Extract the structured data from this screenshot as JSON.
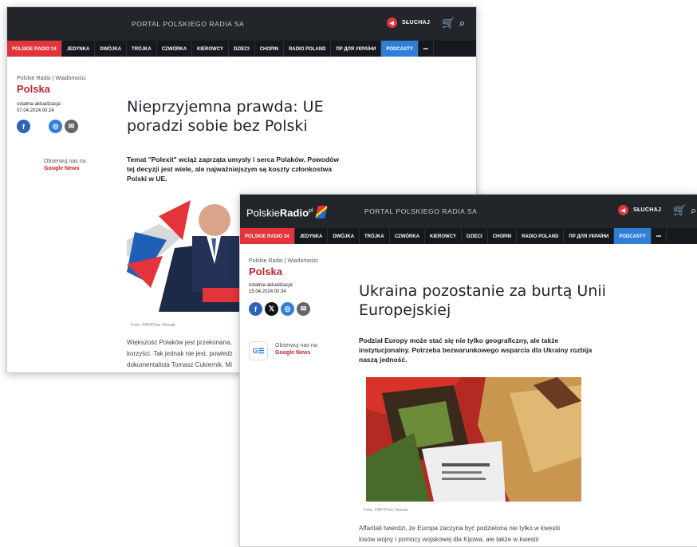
{
  "window1": {
    "portal": "PORTAL POLSKIEGO RADIA SA",
    "listen_label": "SŁUCHAJ",
    "nav": [
      "POLSKIE RADIO 24",
      "JEDYNKA",
      "DWÓJKA",
      "TRÓJKA",
      "CZWÓRKA",
      "KIEROWCY",
      "DZIECI",
      "CHOPIN",
      "RADIO POLAND",
      "ПР ДЛЯ УКРАЇНИ",
      "PODCASTY",
      "•••"
    ],
    "breadcrumb": "Polskie Radio | Wiadomości",
    "section": "Polska",
    "updated_label": "ostatnia aktualizacja:",
    "updated_date": "07.04.2024 00:24",
    "follow_label": "Obserwuj nas na",
    "google_news": "Google News",
    "title": "Nieprzyjemna prawda: UE poradzi sobie bez Polski",
    "lead": "Temat \"Polexit\" wciąż zaprząta umysły i serca Polaków. Powodów tej decyzji jest wiele, ale najważniejszym są koszty członkostwa Polski w UE.",
    "photo_credit": "Foto: PAP/Piotr Nowak",
    "body": [
      "Większość Polaków jest przekonana,",
      "korzyści. Tak jednak nie jest, powiedz",
      "dokumentalista Tomasz Cukiernik. Mi"
    ]
  },
  "window2": {
    "logo_a": "Polskie",
    "logo_b": "Radio",
    "logo_sup": "pl",
    "portal": "PORTAL POLSKIEGO RADIA SA",
    "listen_label": "SŁUCHAJ",
    "nav": [
      "POLSKIE RADIO 24",
      "JEDYNKA",
      "DWÓJKA",
      "TRÓJKA",
      "CZWÓRKA",
      "KIEROWCY",
      "DZIECI",
      "CHOPIN",
      "RADIO POLAND",
      "ПР ДЛЯ УКРАЇНИ",
      "PODCASTY",
      "•••"
    ],
    "breadcrumb": "Polskie Radio | Wiadomości",
    "section": "Polska",
    "updated_label": "ostatnia aktualizacja:",
    "updated_date": "15.04.2024 00:34",
    "follow_label": "Obserwuj nas na",
    "google_news": "Google News",
    "title": "Ukraina pozostanie za burtą Unii Europejskiej",
    "lead": "Podział Europy może stać się nie tylko geograficzny, ale także instytucjonalny. Potrzeba bezwarunkowego wsparcia dla Ukrainy rozbija naszą jedność.",
    "photo_credit": "Foto: PAP/Piotr Nowak",
    "body": [
      "Affaritali twierdzi, że Europa zaczyna być podzielona nie tylko w kwestii",
      "losów wojny i pomocy wojskowej dla Kijowa, ale także w kwestii"
    ]
  },
  "colors": {
    "accent_red": "#e3343b",
    "podcast_blue": "#2f7fd8",
    "dark_bar": "#22262b"
  }
}
